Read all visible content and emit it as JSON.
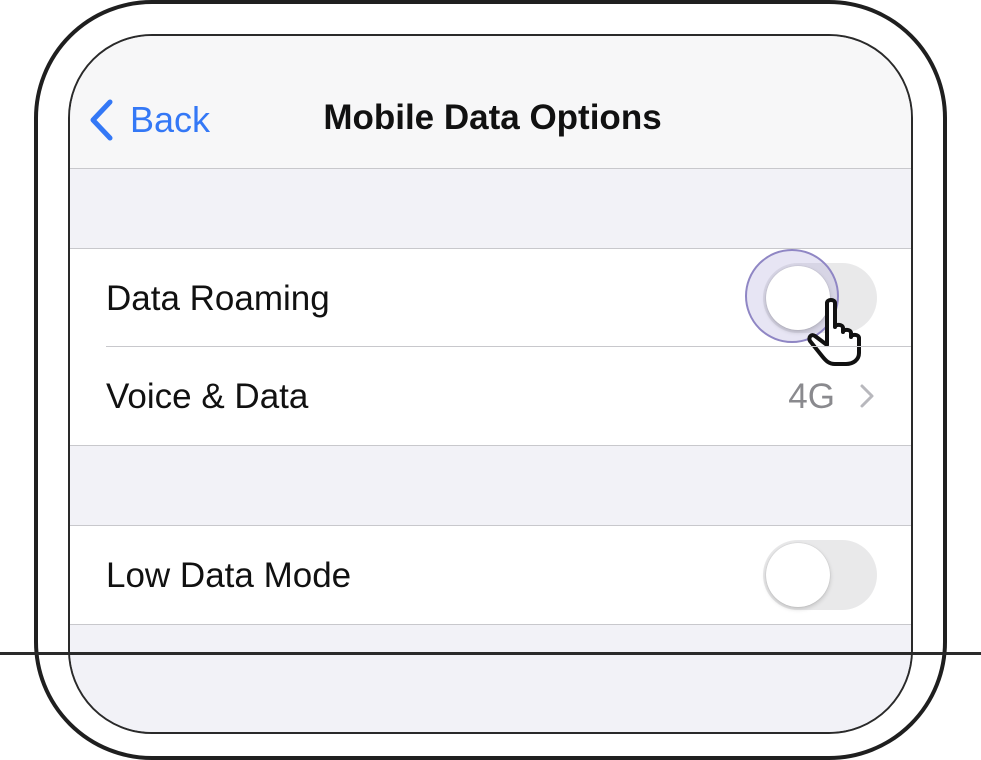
{
  "nav": {
    "back_label": "Back",
    "title": "Mobile Data Options"
  },
  "settings": {
    "group1": [
      {
        "label": "Data Roaming",
        "control": "toggle",
        "state": "off"
      },
      {
        "label": "Voice & Data",
        "value": "4G",
        "control": "disclosure"
      }
    ],
    "group2": [
      {
        "label": "Low Data Mode",
        "control": "toggle",
        "state": "off"
      }
    ]
  },
  "icons": {
    "back": "chevron-left-icon",
    "disclosure": "chevron-right-icon",
    "cursor": "hand-pointer-icon"
  },
  "colors": {
    "accent": "#3478f6",
    "toggle_off": "#e9e9ea",
    "secondary_text": "#8a8a8e",
    "tap_highlight": "#8f86c4"
  }
}
